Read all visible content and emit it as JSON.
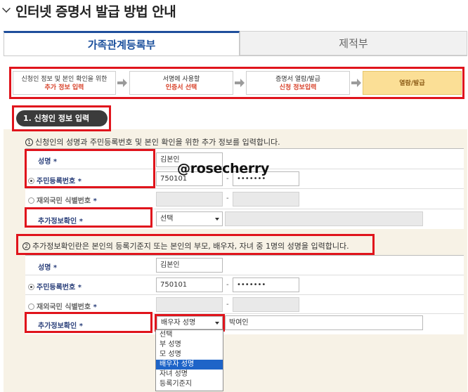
{
  "page": {
    "title": "인터넷 증명서 발급 방법 안내",
    "watermark": "@rosecherry"
  },
  "tabs": [
    {
      "label": "가족관계등록부",
      "active": true
    },
    {
      "label": "제적부",
      "active": false
    }
  ],
  "steps": [
    {
      "line1": "신청인 정보 및 본인 확인을 위한",
      "line2": "추가 정보 입력"
    },
    {
      "line1": "서명에 사용할",
      "line2": "인증서 선택"
    },
    {
      "line1": "증명서 열람/발급",
      "line2": "신청 정보입력"
    },
    {
      "line1": "열람/발급",
      "line2": ""
    }
  ],
  "section": {
    "title": "1. 신청인 정보 입력"
  },
  "instructions": {
    "num1": "1",
    "text1": "신청인의 성명과 주민등록번호 및 본인 확인을 위한 추가 정보를 입력합니다.",
    "num2": "2",
    "text2": "추가정보확인란은 본인의 등록기준지 또는 본인의 부모, 배우자, 자녀 중 1명의 성명을 입력합니다."
  },
  "form1": {
    "name_label": "성명",
    "name_value": "김본인",
    "rrn_label": "주민등록번호",
    "rrn_front": "750101",
    "rrn_back": "•••••••",
    "foreign_label": "재외국민 식별번호",
    "extra_label": "추가정보확인",
    "extra_select": "선택",
    "star": "*"
  },
  "form2": {
    "name_label": "성명",
    "name_value": "김본인",
    "rrn_label": "주민등록번호",
    "rrn_front": "750101",
    "rrn_back": "•••••••",
    "foreign_label": "재외국민 식별번호",
    "extra_label": "추가정보확인",
    "extra_select": "배우자 성명",
    "extra_value": "박여인",
    "star": "*"
  },
  "dash": "-",
  "dropdown_options": [
    "선택",
    "부 성명",
    "모 성명",
    "배우자 성명",
    "자녀 성명",
    "등록기준지"
  ],
  "dropdown_selected_index": 3,
  "colors": {
    "accent": "#1f4f9c",
    "highlight": "#e0141c",
    "step_active": "#fbdf96"
  }
}
